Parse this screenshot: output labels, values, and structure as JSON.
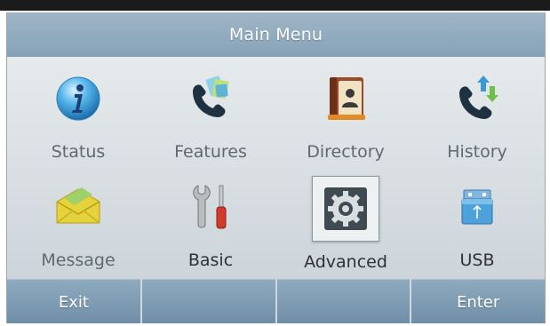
{
  "header": {
    "title": "Main Menu"
  },
  "menu": {
    "items": [
      {
        "label": "Status",
        "icon": "info-icon"
      },
      {
        "label": "Features",
        "icon": "phone-features-icon"
      },
      {
        "label": "Directory",
        "icon": "contact-book-icon"
      },
      {
        "label": "History",
        "icon": "phone-history-icon"
      },
      {
        "label": "Message",
        "icon": "envelope-icon"
      },
      {
        "label": "Basic",
        "icon": "wrench-screwdriver-icon"
      },
      {
        "label": "Advanced",
        "icon": "gear-icon",
        "selected": true
      },
      {
        "label": "USB",
        "icon": "usb-drive-icon"
      }
    ]
  },
  "softkeys": {
    "left": "Exit",
    "mid1": "",
    "mid2": "",
    "right": "Enter"
  },
  "colors": {
    "title_bar": "#8fa9bc",
    "softkey": "#7b98ae",
    "background": "#d7dde0"
  }
}
